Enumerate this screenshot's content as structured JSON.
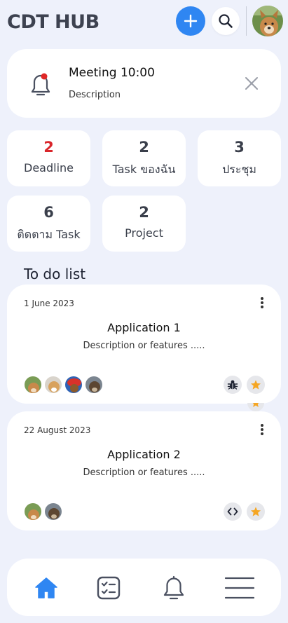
{
  "header": {
    "app_title": "CDT HUB",
    "add_icon": "plus-icon",
    "search_icon": "search-icon",
    "accent_color": "#2f86f2"
  },
  "notification": {
    "title": "Meeting 10:00",
    "description": "Description",
    "icon": "bell-icon",
    "dot_color": "#e02727"
  },
  "stats": [
    {
      "count": "2",
      "label": "Deadline",
      "color": "#d9262b"
    },
    {
      "count": "2",
      "label": "Task ของฉัน"
    },
    {
      "count": "3",
      "label": "ประชุม"
    },
    {
      "count": "6",
      "label": "ติดตาม Task"
    },
    {
      "count": "2",
      "label": "Project"
    }
  ],
  "todo": {
    "section_title": "To do list",
    "items": [
      {
        "date": "1 June 2023",
        "title": "Application 1",
        "description": "Description or features .....",
        "tags": [
          "bug-icon",
          "star-icon"
        ]
      },
      {
        "date": "22 August 2023",
        "title": "Application 2",
        "description": "Description or features .....",
        "tags": [
          "code-icon",
          "star-icon"
        ]
      }
    ]
  },
  "bottom_nav": {
    "items": [
      "home-icon",
      "checklist-icon",
      "bell-icon",
      "menu-icon"
    ],
    "active": "home-icon"
  }
}
